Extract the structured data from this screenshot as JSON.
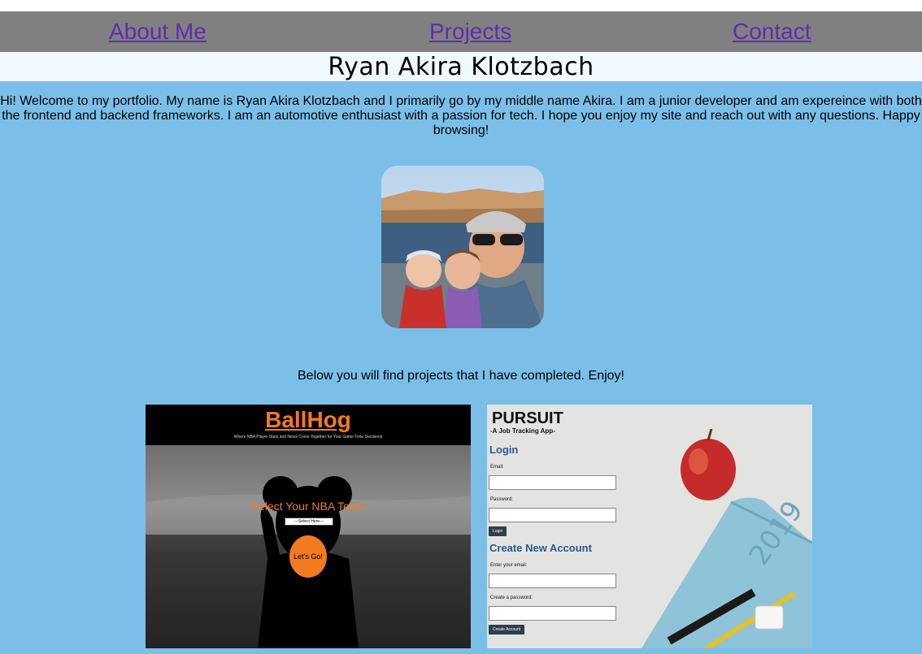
{
  "nav": {
    "about": "About Me",
    "projects": "Projects",
    "contact": "Contact"
  },
  "header": {
    "name": "Ryan Akira Klotzbach"
  },
  "intro": {
    "text": "Hi! Welcome to my portfolio. My name is Ryan Akira Klotzbach and I primarily go by my middle name Akira. I am a junior developer and am expereince with both the frontend and backend frameworks. I am an automotive enthusiast with a passion for tech. I hope you enjoy my site and reach out with any questions. Happy browsing!"
  },
  "projects_note": "Below you will find projects that I have completed. Enjoy!",
  "projects": {
    "ballhog": {
      "title": "BallHog",
      "tagline": "Where NBA Player Stats and News Come Together for Your Game Time Decisions",
      "select_label": "Select Your NBA Team",
      "select_value": "---Select Here---",
      "go_button": "Let's Go!",
      "accent_color": "#f47a20"
    },
    "pursuit": {
      "title": "PURSUIT",
      "subtitle": "-A Job Tracking App-",
      "login_heading": "Login",
      "email_label": "Email:",
      "password_label": "Password:",
      "login_button": "Login",
      "create_heading": "Create New Account",
      "enter_email_label": "Enter your email:",
      "create_password_label": "Create a password:",
      "create_button": "Create Account",
      "heading_color": "#2a5a8a"
    }
  },
  "colors": {
    "page_bg": "#7bbfe9",
    "nav_bg": "#808080",
    "link": "#5b2fb0",
    "name_bar_bg": "#f1f8fe"
  },
  "icons": {
    "avatar": "profile-photo"
  }
}
